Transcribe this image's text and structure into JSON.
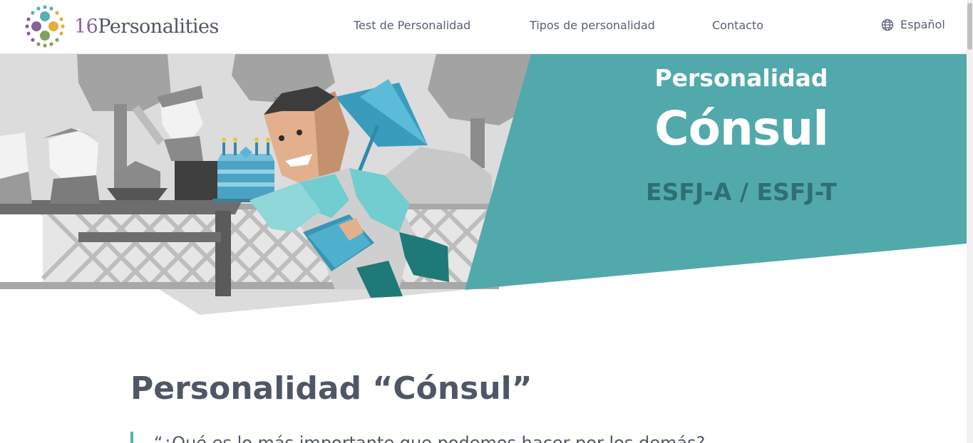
{
  "header": {
    "logo_number": "16",
    "logo_word": "Personalities",
    "nav": [
      {
        "label": "Test de Personalidad"
      },
      {
        "label": "Tipos de personalidad"
      },
      {
        "label": "Contacto"
      }
    ],
    "language": {
      "label": "Español",
      "icon": "globe-icon"
    }
  },
  "hero": {
    "kicker": "Personalidad",
    "title": "Cónsul",
    "codes": "ESFJ-A / ESFJ-T",
    "colors": {
      "teal_panel": "#52a9ac",
      "code_text": "#2f6f73"
    }
  },
  "content": {
    "heading": "Personalidad “Cónsul”",
    "quote_start": "“¿Qué es lo más importante que podemos hacer por los demás?"
  },
  "colors": {
    "text": "#4f5767",
    "nav_text": "#576071",
    "accent": "#56b1b0"
  }
}
